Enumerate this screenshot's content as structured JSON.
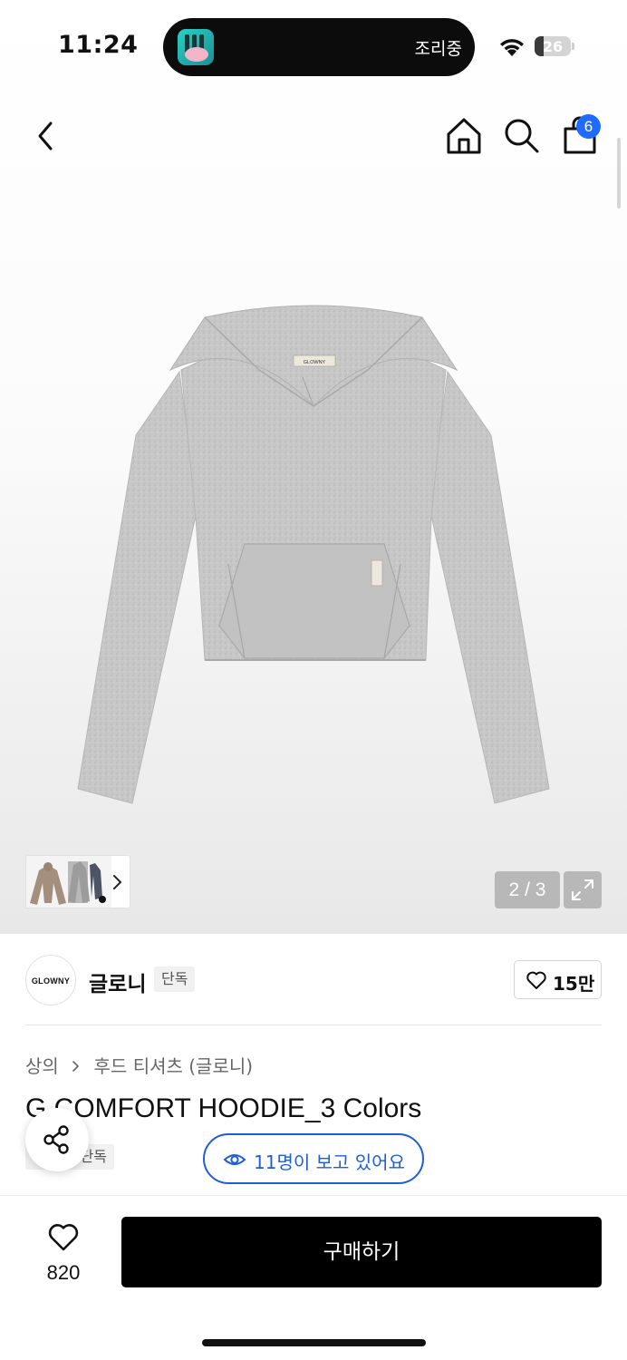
{
  "status_bar": {
    "time": "11:24",
    "live_activity_label": "조리중",
    "battery_level": "26"
  },
  "nav": {
    "cart_count": "6"
  },
  "gallery": {
    "current_page": "2",
    "total_pages": "3",
    "separator": "/",
    "label_tag": "GLOWNY"
  },
  "brand": {
    "logo_text": "GLOWNY",
    "name": "글로니",
    "tag": "단독",
    "likes": "15만"
  },
  "product": {
    "breadcrumb": [
      "상의",
      "후드 티셔츠 (글로니)"
    ],
    "title": "G COMFORT HOODIE_3 Colors",
    "tag": "단독",
    "viewers_text": "11명이 보고 있어요"
  },
  "bottom": {
    "wish_count": "820",
    "buy_label": "구매하기"
  },
  "colors": {
    "accent_blue": "#1f5ed8",
    "badge_blue": "#1f6bff",
    "hoodie_grey": "#c6c6c6",
    "buy_black": "#000000"
  }
}
